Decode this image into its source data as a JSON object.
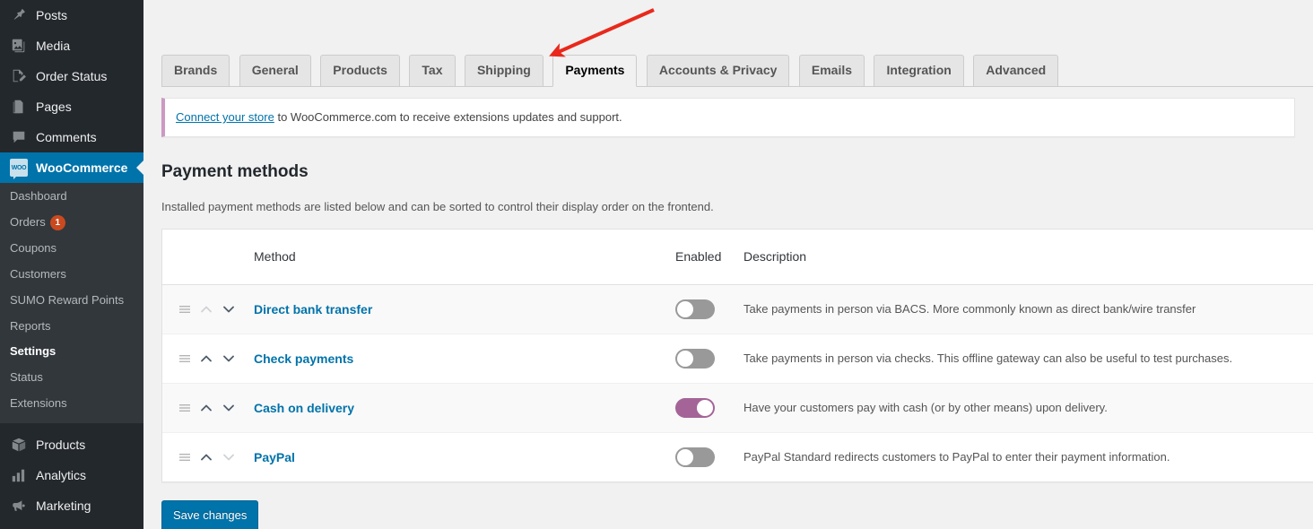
{
  "sidebar": {
    "top_items": [
      {
        "label": "Posts",
        "icon": "pin-icon",
        "current": false
      },
      {
        "label": "Media",
        "icon": "media-icon",
        "current": false
      },
      {
        "label": "Order Status",
        "icon": "pencil-page-icon",
        "current": false
      },
      {
        "label": "Pages",
        "icon": "pages-icon",
        "current": false
      },
      {
        "label": "Comments",
        "icon": "comment-icon",
        "current": false
      },
      {
        "label": "WooCommerce",
        "icon": "woocommerce-icon",
        "current": true
      }
    ],
    "submenu": [
      {
        "label": "Dashboard",
        "current": false,
        "badge": ""
      },
      {
        "label": "Orders",
        "current": false,
        "badge": "1"
      },
      {
        "label": "Coupons",
        "current": false,
        "badge": ""
      },
      {
        "label": "Customers",
        "current": false,
        "badge": ""
      },
      {
        "label": "SUMO Reward Points",
        "current": false,
        "badge": ""
      },
      {
        "label": "Reports",
        "current": false,
        "badge": ""
      },
      {
        "label": "Settings",
        "current": true,
        "badge": ""
      },
      {
        "label": "Status",
        "current": false,
        "badge": ""
      },
      {
        "label": "Extensions",
        "current": false,
        "badge": ""
      }
    ],
    "bottom_items": [
      {
        "label": "Products",
        "icon": "box-icon",
        "current": false
      },
      {
        "label": "Analytics",
        "icon": "bar-chart-icon",
        "current": false
      },
      {
        "label": "Marketing",
        "icon": "megaphone-icon",
        "current": false
      }
    ]
  },
  "tabs": [
    {
      "label": "Brands",
      "active": false
    },
    {
      "label": "General",
      "active": false
    },
    {
      "label": "Products",
      "active": false
    },
    {
      "label": "Tax",
      "active": false
    },
    {
      "label": "Shipping",
      "active": false
    },
    {
      "label": "Payments",
      "active": true
    },
    {
      "label": "Accounts & Privacy",
      "active": false
    },
    {
      "label": "Emails",
      "active": false
    },
    {
      "label": "Integration",
      "active": false
    },
    {
      "label": "Advanced",
      "active": false
    }
  ],
  "notice": {
    "link_text": "Connect your store",
    "rest_text": " to WooCommerce.com to receive extensions updates and support.",
    "accent_color": "#cc99c2"
  },
  "page": {
    "title": "Payment methods",
    "description": "Installed payment methods are listed below and can be sorted to control their display order on the frontend."
  },
  "table": {
    "columns": [
      "",
      "Method",
      "Enabled",
      "Description"
    ],
    "rows": [
      {
        "method": "Direct bank transfer",
        "enabled": false,
        "description": "Take payments in person via BACS. More commonly known as direct bank/wire transfer",
        "can_move_up": false,
        "can_move_down": true
      },
      {
        "method": "Check payments",
        "enabled": false,
        "description": "Take payments in person via checks. This offline gateway can also be useful to test purchases.",
        "can_move_up": true,
        "can_move_down": true
      },
      {
        "method": "Cash on delivery",
        "enabled": true,
        "description": "Have your customers pay with cash (or by other means) upon delivery.",
        "can_move_up": true,
        "can_move_down": true
      },
      {
        "method": "PayPal",
        "enabled": false,
        "description": "PayPal Standard redirects customers to PayPal to enter their payment information.",
        "can_move_up": true,
        "can_move_down": false
      }
    ]
  },
  "actions": {
    "save_label": "Save changes"
  },
  "annotation": {
    "arrow_color": "#e8291c"
  },
  "colors": {
    "accent_blue": "#0073aa",
    "toggle_on": "#a46497",
    "toggle_off": "#999999",
    "badge_red": "#ca4a1f"
  }
}
